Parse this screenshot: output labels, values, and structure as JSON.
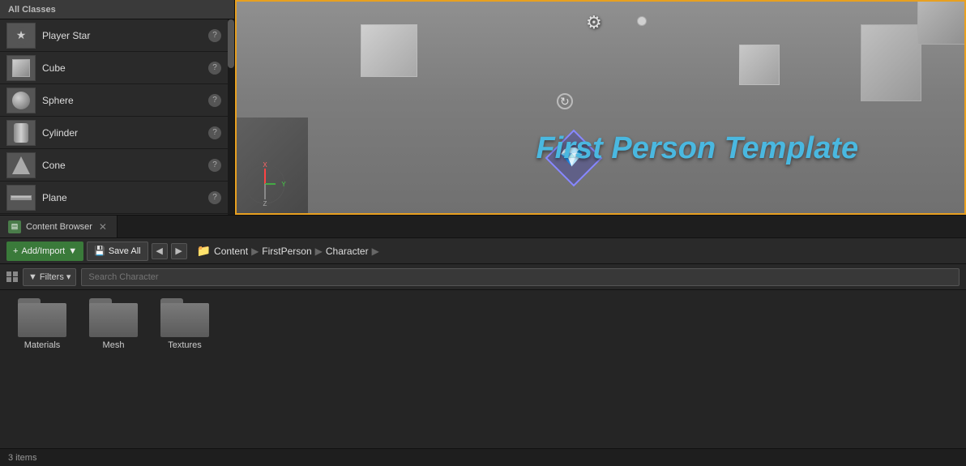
{
  "left_panel": {
    "header": "All Classes",
    "classes": [
      {
        "id": "player-star",
        "name": "Player Star",
        "icon_type": "player-star",
        "has_info": true
      },
      {
        "id": "cube",
        "name": "Cube",
        "icon_type": "cube",
        "has_info": true
      },
      {
        "id": "sphere",
        "name": "Sphere",
        "icon_type": "sphere",
        "has_info": true
      },
      {
        "id": "cylinder",
        "name": "Cylinder",
        "icon_type": "cylinder",
        "has_info": true
      },
      {
        "id": "cone",
        "name": "Cone",
        "icon_type": "cone",
        "has_info": true
      },
      {
        "id": "plane",
        "name": "Plane",
        "icon_type": "plane",
        "has_info": true
      }
    ]
  },
  "viewport": {
    "title": "First Person Template"
  },
  "content_browser": {
    "tab_label": "Content Browser",
    "tab_icon": "CB",
    "toolbar": {
      "add_import_label": "Add/Import",
      "save_all_label": "Save All",
      "nav_back": "◀",
      "nav_forward": "▶",
      "breadcrumb": [
        "Content",
        "FirstPerson",
        "Character"
      ]
    },
    "filters_label": "Filters",
    "search_placeholder": "Search Character",
    "folders": [
      {
        "id": "materials",
        "label": "Materials"
      },
      {
        "id": "mesh",
        "label": "Mesh"
      },
      {
        "id": "textures",
        "label": "Textures"
      }
    ],
    "status": "3 items"
  }
}
